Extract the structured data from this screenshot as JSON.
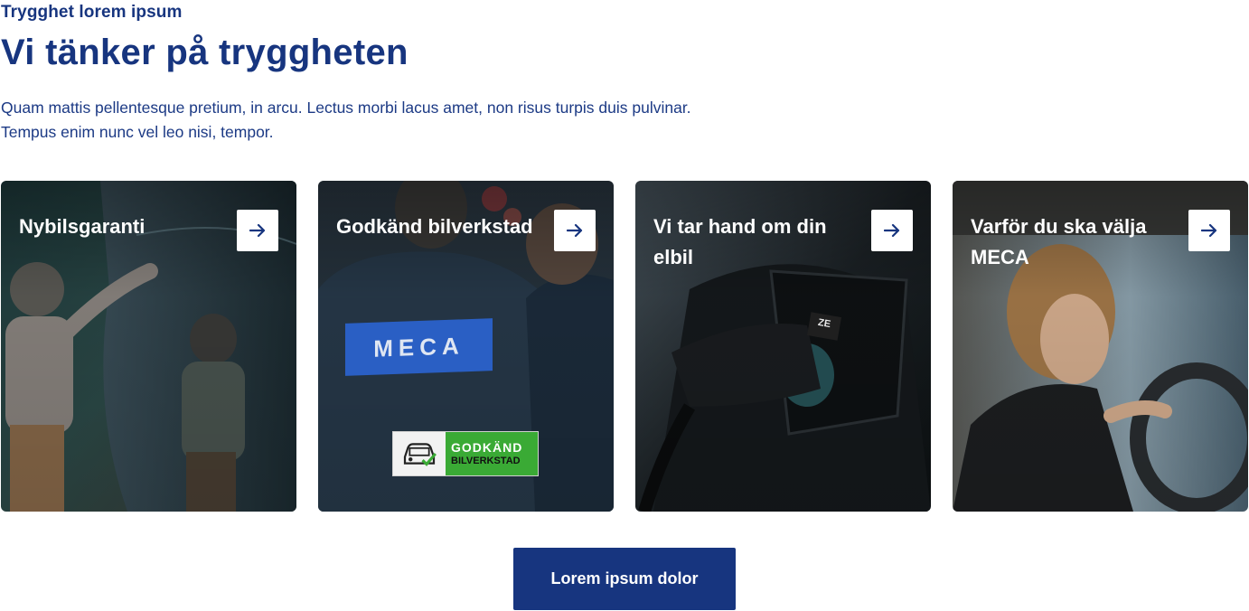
{
  "header": {
    "eyebrow": "Trygghet lorem ipsum",
    "title": "Vi tänker på tryggheten",
    "intro": "Quam mattis pellentesque pretium, in arcu. Lectus morbi lacus amet, non risus turpis duis pulvinar. Tempus enim nunc vel leo nisi, tempor."
  },
  "cards": [
    {
      "title": "Nybilsgaranti",
      "icon": "arrow-right-icon",
      "image": "child-touching-car-photo"
    },
    {
      "title": "Godkänd bilverkstad",
      "icon": "arrow-right-icon",
      "image": "meca-mechanic-photo",
      "logo_text": "MECA",
      "badge_line1": "GODKÄND",
      "badge_line2": "BILVERKSTAD"
    },
    {
      "title": "Vi tar hand om din elbil",
      "icon": "arrow-right-icon",
      "image": "ev-charging-port-photo",
      "plug_label": "ZE"
    },
    {
      "title": "Varför du ska välja MECA",
      "icon": "arrow-right-icon",
      "image": "woman-driving-photo"
    }
  ],
  "cta": {
    "label": "Lorem ipsum dolor"
  },
  "colors": {
    "brand": "#17357f",
    "badge_green": "#3aaa35",
    "meca_blue": "#2a5fc4"
  }
}
